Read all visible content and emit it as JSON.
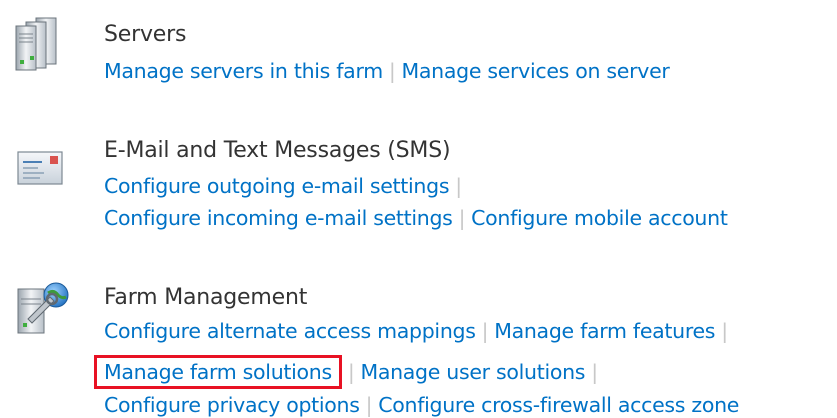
{
  "sections": [
    {
      "title": "Servers",
      "icon": "servers-icon",
      "lines": [
        [
          "Manage servers in this farm",
          "Manage services on server"
        ]
      ]
    },
    {
      "title": "E-Mail and Text Messages (SMS)",
      "icon": "email-icon",
      "lines": [
        [
          "Configure outgoing e-mail settings"
        ],
        [
          "Configure incoming e-mail settings",
          "Configure mobile account"
        ]
      ]
    },
    {
      "title": "Farm Management",
      "icon": "farm-management-icon",
      "lines": [
        [
          "Configure alternate access mappings",
          "Manage farm features"
        ],
        [
          "Manage farm solutions",
          "Manage user solutions"
        ],
        [
          "Configure privacy options",
          "Configure cross-firewall access zone"
        ]
      ]
    }
  ],
  "separator": "|",
  "highlight_color": "#e81123",
  "link_color": "#0072c6"
}
